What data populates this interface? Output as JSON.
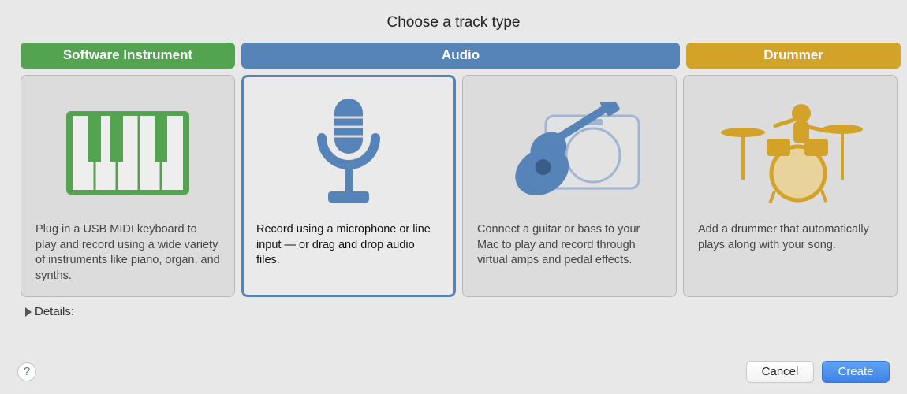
{
  "title": "Choose a track type",
  "headers": {
    "software": "Software Instrument",
    "audio": "Audio",
    "drummer": "Drummer"
  },
  "cards": {
    "software": {
      "desc": "Plug in a USB MIDI keyboard to play and record using a wide variety of instruments like piano, organ, and synths."
    },
    "audio_mic": {
      "desc": "Record using a microphone or line input — or drag and drop audio files."
    },
    "audio_guitar": {
      "desc": "Connect a guitar or bass to your Mac to play and record through virtual amps and pedal effects."
    },
    "drummer": {
      "desc": "Add a drummer that automatically plays along with your song."
    }
  },
  "details_label": "Details:",
  "help_glyph": "?",
  "buttons": {
    "cancel": "Cancel",
    "create": "Create"
  },
  "colors": {
    "green": "#53a351",
    "blue": "#5784b8",
    "gold": "#d2a229",
    "primary_button": "#3f82e6"
  }
}
